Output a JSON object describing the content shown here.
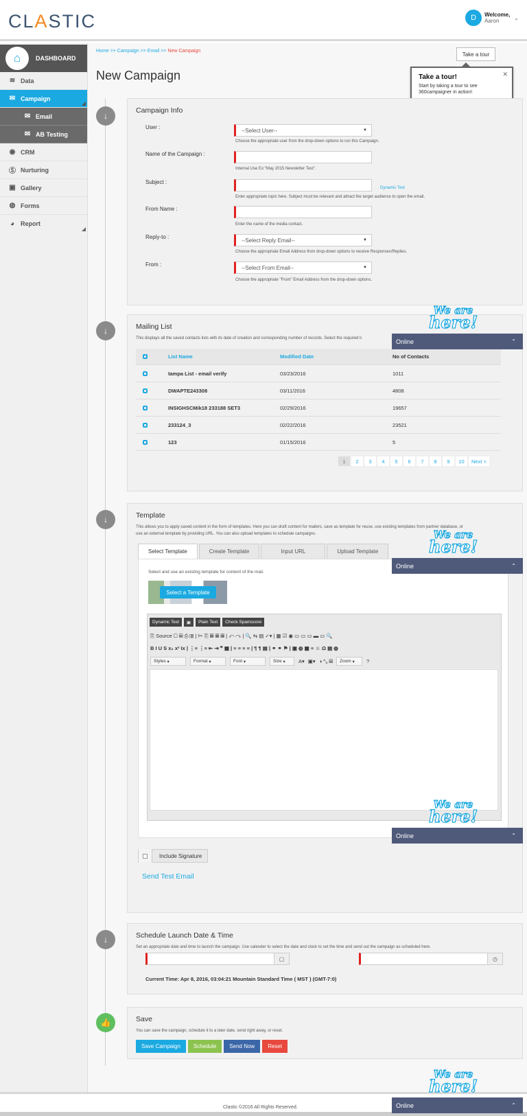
{
  "header": {
    "logo": {
      "left": "CL",
      "accent": "A",
      "right": "STIC"
    },
    "avatar_letter": "D",
    "welcome": "Welcome,",
    "user": "Aaron"
  },
  "sidebar": {
    "dashboard": "DASHBOARD",
    "items": [
      {
        "label": "Data"
      },
      {
        "label": "Campaign"
      },
      {
        "label": "Email"
      },
      {
        "label": "AB Testing"
      },
      {
        "label": "CRM"
      },
      {
        "label": "Nurturing"
      },
      {
        "label": "Gallery"
      },
      {
        "label": "Forms"
      },
      {
        "label": "Report"
      }
    ]
  },
  "breadcrumb": {
    "home": "Home",
    "sep": ">>",
    "campaign": "Campaign",
    "email": "Email",
    "current": "New Campaign"
  },
  "page_title": "New Campaign",
  "tour": {
    "button": "Take a tour",
    "title": "Take a tour!",
    "text": "Start by taking a tour to see 360campaigner in action!"
  },
  "campaign_info": {
    "title": "Campaign Info",
    "fields": [
      {
        "label": "User :",
        "value": "--Select User--",
        "help": "Choose the appropriate user from the drop-down options to run this Campaign."
      },
      {
        "label": "Name of the Campaign :",
        "value": "",
        "help": "Internal Use Ex:\"May 2015 Newsletter Test\"."
      },
      {
        "label": "Subject :",
        "value": "",
        "help": "Enter appropriate topic here. Subject must be relevant and attract the target audience to open the email."
      },
      {
        "label": "From Name :",
        "value": "",
        "help": "Enter the name of the media contact."
      },
      {
        "label": "Reply-to :",
        "value": "--Select Reply Email--",
        "help": "Choose the appropriate Email Address from drop-down options to receive Responses/Replies."
      },
      {
        "label": "From :",
        "value": "--Select From Email--",
        "help": "Choose the appropriate \"From\" Email Address from the drop-down options."
      }
    ],
    "dynamic_text": "Dynamic Text"
  },
  "mailing_list": {
    "title": "Mailing List",
    "desc": "This displays all the saved contacts lists with its date of creation and corresponding number of records. Select the required li",
    "columns": [
      "List Name",
      "Modified Date",
      "No of Contacts"
    ],
    "rows": [
      {
        "name": "tampa List - email verify",
        "date": "03/23/2016",
        "count": "1011"
      },
      {
        "name": "DWAPTE243308",
        "date": "03/11/2016",
        "count": "4808"
      },
      {
        "name": "INSIGHSCMik18 233188 SET3",
        "date": "02/29/2016",
        "count": "19657"
      },
      {
        "name": "233124_3",
        "date": "02/22/2016",
        "count": "23521"
      },
      {
        "name": "123",
        "date": "01/15/2016",
        "count": "5"
      }
    ],
    "pages": [
      "1",
      "2",
      "3",
      "4",
      "5",
      "6",
      "7",
      "8",
      "9",
      "10",
      "Next >"
    ]
  },
  "template": {
    "title": "Template",
    "desc1": "This allows you to apply saved content in the form of templates. Here you can draft content for mailers, save as template for reuse, use existing templates from partner database, or",
    "desc2": "use an external template by providing URL. You can also upload templates to schedule campaigns.",
    "tabs": [
      "Select Template",
      "Create Template",
      "Input URL",
      "Upload Template"
    ],
    "select_help": "Select and use an existing template for content of the mail.",
    "select_button": "Select a Template",
    "editor_top": [
      "Dynamic Text",
      "▣",
      "Plain Text",
      "Check Spamscore"
    ],
    "toolbar_row1": "⎘ Source  ▢  ▤  ⎙  ▥  |  ✂  ⎘  ▦  ▦  ▦  |  ↶  ↷  |  🔍  ⇆  ▤  ✓▾  |  ▦  ☑  ◉  ▭  ▭  ▭  ▬  ▭  🔍",
    "toolbar_row2": "B  I  U  S  x₂  x²  Ix  |  ⋮≡  ⋮≡  ⇤  ⇥  ❞  ▦  |  ≡  ≡  ≡  ≡  |  ¶  ¶  ▤  |  ⚭  ⚭  ⚑  |  ▣  ◍  ▦  ≡  ☺  Ω  ▤  ◍",
    "combos": [
      "Styles",
      "Format",
      "Font",
      "Size"
    ],
    "zoom": "Zoom",
    "signature": "Include Signature",
    "send_test": "Send Test Email"
  },
  "schedule": {
    "title": "Schedule Launch Date & Time",
    "desc": "Set an appropriate date and time to launch the campaign. Use calender to select the date and clock to set the time and send out the campaign as scheduled here.",
    "current_time": "Current Time: Apr 8, 2016, 03:04:21 Mountain Standard Time ( MST ) (GMT-7:0)"
  },
  "save": {
    "title": "Save",
    "desc": "You can save the campaign, schedule it to a later date, send right away, or reset.",
    "buttons": [
      "Save Campaign",
      "Schedule",
      "Send Now",
      "Reset"
    ]
  },
  "chat": {
    "logo_line1": "We are",
    "logo_line2": "here!",
    "status": "Online"
  },
  "footer": "Clastic ©2016 All Rights Reserved.",
  "colors": {
    "accent": "#1ba9e1",
    "brand_orange": "#f5881f",
    "required": "#e02020",
    "save_green": "#8cc34f",
    "send_blue": "#3b66a8",
    "reset_red": "#e8483e",
    "chat_bar": "#4f5a7a"
  }
}
